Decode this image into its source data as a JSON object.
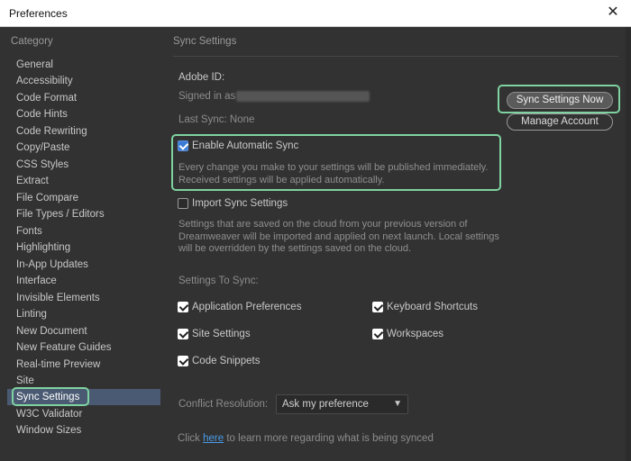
{
  "window": {
    "title": "Preferences",
    "close_glyph": "✕"
  },
  "sidebar": {
    "header": "Category",
    "items": [
      "General",
      "Accessibility",
      "Code Format",
      "Code Hints",
      "Code Rewriting",
      "Copy/Paste",
      "CSS Styles",
      "Extract",
      "File Compare",
      "File Types / Editors",
      "Fonts",
      "Highlighting",
      "In-App Updates",
      "Interface",
      "Invisible Elements",
      "Linting",
      "New Document",
      "New Feature Guides",
      "Real-time Preview",
      "Site",
      "Sync Settings",
      "W3C Validator",
      "Window Sizes"
    ],
    "active": "Sync Settings"
  },
  "panel": {
    "title": "Sync Settings",
    "adobe_id_label": "Adobe ID:",
    "signed_in_label": "Signed in as",
    "last_sync": "Last Sync: None",
    "sync_now_button": "Sync Settings Now",
    "manage_account_button": "Manage Account",
    "auto_sync": {
      "label": "Enable Automatic Sync",
      "checked": true,
      "description_line1": "Every change you make to your settings will be published immediately.",
      "description_line2": "Received settings will be applied automatically."
    },
    "import_sync": {
      "label": "Import Sync Settings",
      "checked": false,
      "description_line1": "Settings that are saved on the cloud from your previous version of",
      "description_line2": "Dreamweaver will be imported and applied on next launch. Local settings",
      "description_line3": "will be overridden by the settings saved on the cloud."
    },
    "settings_to_sync_label": "Settings To Sync:",
    "sync_items": [
      {
        "label": "Application Preferences",
        "checked": true
      },
      {
        "label": "Keyboard Shortcuts",
        "checked": true
      },
      {
        "label": "Site Settings",
        "checked": true
      },
      {
        "label": "Workspaces",
        "checked": true
      },
      {
        "label": "Code Snippets",
        "checked": true
      }
    ],
    "conflict_label": "Conflict Resolution:",
    "conflict_value": "Ask my preference",
    "footer_prefix": "Click",
    "footer_link": "here",
    "footer_suffix": "to learn more regarding what is being synced"
  },
  "colors": {
    "accent": "#3a7bd5",
    "highlight": "#7fd3a0",
    "active_row": "#4a5a72"
  }
}
